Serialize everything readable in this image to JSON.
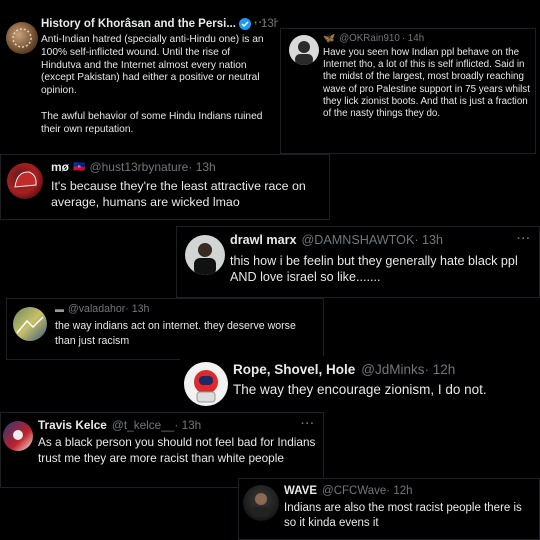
{
  "tweets": [
    {
      "name": "History of Khorâsan and the Persi...",
      "handle": "",
      "time": "· 13h",
      "text": "Anti-Indian hatred (specially anti-Hindu one) is an 100% self-inflicted wound. Until the rise of Hindutva and the Internet almost every nation (except Pakistan) had either a positive or neutral opinion.",
      "text2": "The awful behavior of some Hindu Indians ruined their own reputation.",
      "verified": true,
      "more": "···"
    },
    {
      "name": "",
      "name_emoji": "🦋",
      "handle": "@OKRain910",
      "time": "· 14h",
      "text": "Have you seen how Indian ppl behave on the Internet tho, a lot of this is self inflicted. Said in the midst of the largest, most broadly reaching wave of pro Palestine support in 75 years whilst they lick zionist boots. And that is just a fraction of the nasty things they do.",
      "more": "···"
    },
    {
      "name": "mø",
      "name_emoji": "🇭🇹",
      "handle": "@hust13rbynature",
      "time": "· 13h",
      "text": "It's because they're the least attractive race on average, humans are wicked lmao",
      "more": "···"
    },
    {
      "name": "drawl marx",
      "handle": "@DAMNSHAWTOK",
      "time": "· 13h",
      "text": "this how i be feelin but they generally hate black ppl AND love israel so like.......",
      "more": "···"
    },
    {
      "name": "",
      "name_emoji": "▬",
      "handle": "@valadahor",
      "time": "· 13h",
      "text": "the way indians act on internet. they deserve worse than just racism",
      "more": "···"
    },
    {
      "name": "Rope, Shovel, Hole",
      "handle": "@JdMinks",
      "time": "· 12h",
      "text": "The way they encourage zionism, I do not.",
      "more": "···"
    },
    {
      "name": "Travis Kelce",
      "handle": "@t_kelce__",
      "time": "· 13h",
      "text": "As a black person you should not feel bad for Indians trust me they are more racist than white people",
      "more": "···"
    },
    {
      "name": "WAVE",
      "handle": "@CFCWave",
      "time": "· 12h",
      "text": "Indians are also the most racist people there is so it kinda evens it",
      "more": "···"
    }
  ],
  "colors": {
    "background": "#000000",
    "text": "#e7e9ea",
    "muted": "#71767b",
    "verified": "#1d9bf0"
  }
}
